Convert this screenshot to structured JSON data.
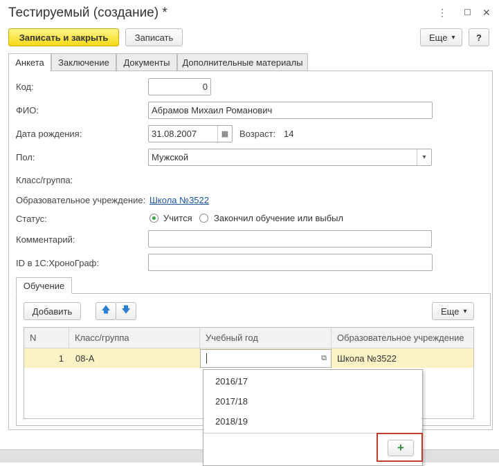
{
  "window": {
    "title": "Тестируемый (создание) *",
    "menu_icon": "⋮",
    "maximize_icon": "☐",
    "close_icon": "✕"
  },
  "toolbar": {
    "save_close_label": "Записать и закрыть",
    "save_label": "Записать",
    "more_label": "Еще",
    "more_arrow": "▾",
    "help_label": "?"
  },
  "tabs": [
    {
      "label": "Анкета",
      "active": true
    },
    {
      "label": "Заключение"
    },
    {
      "label": "Документы"
    },
    {
      "label": "Дополнительные материалы"
    }
  ],
  "form": {
    "code_label": "Код:",
    "code_value": "0",
    "fio_label": "ФИО:",
    "fio_value": "Абрамов Михаил Романович",
    "birth_label": "Дата рождения:",
    "birth_value": "31.08.2007",
    "calendar_icon": "▦",
    "age_label": "Возраст:",
    "age_value": "14",
    "gender_label": "Пол:",
    "gender_value": "Мужской",
    "select_arrow": "▾",
    "class_label": "Класс/группа:",
    "school_label": "Образовательное учреждение:",
    "school_value": "Школа №3522",
    "status_label": "Статус:",
    "status_option1": "Учится",
    "status_option2": "Закончил обучение или выбыл",
    "comment_label": "Комментарий:",
    "comment_value": "",
    "id_label": "ID в 1С:ХроноГраф:",
    "id_value": ""
  },
  "education": {
    "tab_label": "Обучение",
    "add_label": "Добавить",
    "up_icon": "🡅",
    "down_icon": "🡇",
    "more_label": "Еще",
    "more_arrow": "▾",
    "columns": [
      "N",
      "Класс/группа",
      "Учебный год",
      "Образовательное учреждение"
    ],
    "rows": [
      {
        "n": "1",
        "class": "08-А",
        "year": "",
        "school": "Школа №3522"
      }
    ],
    "open_icon": "⧉"
  },
  "dropdown": {
    "items": [
      "2016/17",
      "2017/18",
      "2018/19"
    ],
    "add_icon": "+"
  },
  "colors": {
    "accent_green": "#3aa44a",
    "highlight_red": "#c0392b",
    "row_yellow": "#fbf3c5"
  }
}
